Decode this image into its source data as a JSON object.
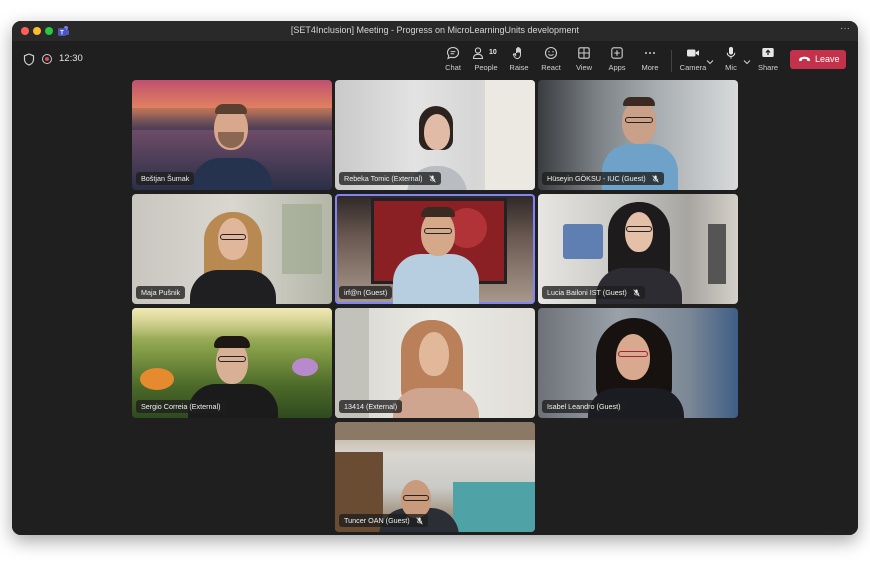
{
  "window": {
    "title": "[SET4Inclusion] Meeting - Progress on MicroLearningUnits development",
    "more_icon": "ellipsis-icon"
  },
  "toolbar": {
    "timer": "12:30",
    "chat": "Chat",
    "people": "People",
    "people_count": "10",
    "raise": "Raise",
    "react": "React",
    "view": "View",
    "apps": "Apps",
    "more": "More",
    "camera": "Camera",
    "mic": "Mic",
    "share": "Share",
    "leave": "Leave"
  },
  "participants": [
    {
      "name": "Boštjan Šumak",
      "muted": false
    },
    {
      "name": "Rebeka Tomic (External)",
      "muted": true
    },
    {
      "name": "Hüseyin GÖKSU - IUC (Guest)",
      "muted": true
    },
    {
      "name": "Maja Pušnik",
      "muted": false
    },
    {
      "name": "irf@n (Guest)",
      "muted": false,
      "active_speaker": true
    },
    {
      "name": "Lucia Bailoni IST (Guest)",
      "muted": true
    },
    {
      "name": "Sergio Correia (External)",
      "muted": false
    },
    {
      "name": "13414 (External)",
      "muted": false
    },
    {
      "name": "Isabel Leandro (Guest)",
      "muted": false
    },
    {
      "name": "Tuncer OAN (Guest)",
      "muted": true
    }
  ],
  "colors": {
    "leave_red": "#c4314b",
    "active_outline": "#7f85f5",
    "background": "#1f1f1f"
  }
}
